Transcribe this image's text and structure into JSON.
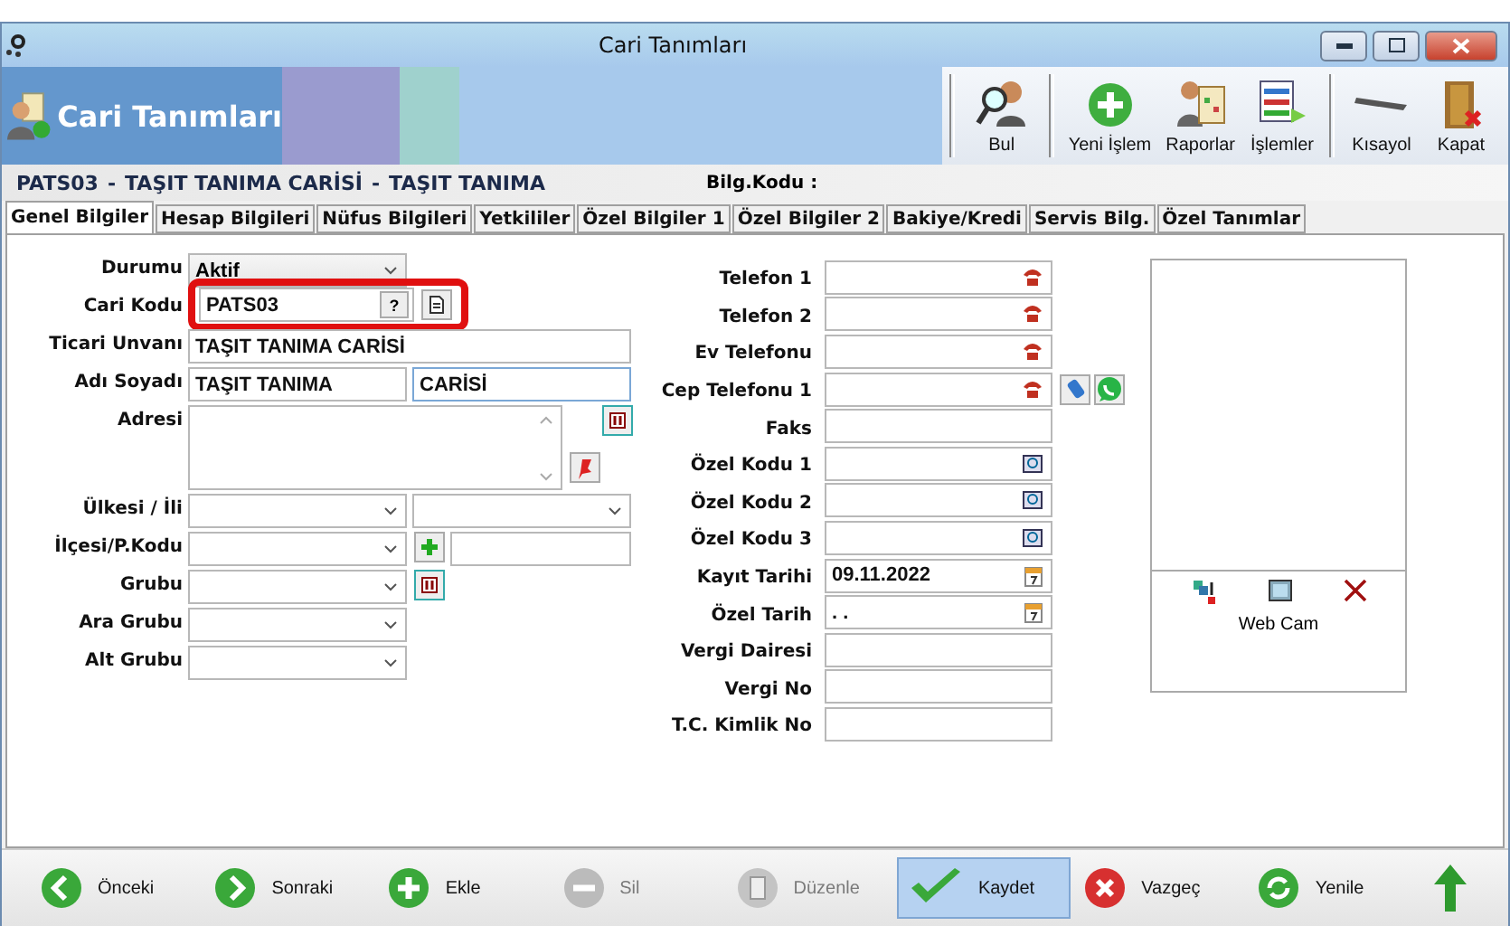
{
  "window": {
    "title": "Cari Tanımları"
  },
  "header": {
    "title": "Cari Tanımları"
  },
  "toolbar_groups": [
    [
      {
        "label": "Bul"
      }
    ],
    [
      {
        "label": "Yeni İşlem"
      },
      {
        "label": "Raporlar"
      },
      {
        "label": "İşlemler"
      }
    ],
    [
      {
        "label": "Kısayol"
      },
      {
        "label": "Kapat"
      }
    ]
  ],
  "record_title": [
    "PATS03",
    "-",
    "TAŞIT TANIMA CARİSİ",
    "-",
    "TAŞIT TANIMA"
  ],
  "bilg_kodu_label": "Bilg.Kodu :",
  "tabs": [
    {
      "label": "Genel Bilgiler",
      "selected": true
    },
    {
      "label": "Hesap Bilgileri",
      "selected": false
    },
    {
      "label": "Nüfus Bilgileri",
      "selected": false
    },
    {
      "label": "Yetkililer",
      "selected": false
    },
    {
      "label": "Özel Bilgiler 1",
      "selected": false
    },
    {
      "label": "Özel Bilgiler 2",
      "selected": false
    },
    {
      "label": "Bakiye/Kredi",
      "selected": false
    },
    {
      "label": "Servis Bilg.",
      "selected": false
    },
    {
      "label": "Özel Tanımlar",
      "selected": false
    }
  ],
  "left_fields": [
    {
      "kind": "select",
      "label": "Durumu",
      "value": "Aktif"
    },
    {
      "kind": "code",
      "label": "Cari Kodu",
      "value": "PATS03",
      "button": "?",
      "highlighted": true
    },
    {
      "kind": "text",
      "label": "Ticari Unvanı",
      "value": "TAŞIT TANIMA CARİSİ"
    },
    {
      "kind": "split",
      "label": "Adı Soyadı",
      "value": "TAŞIT TANIMA",
      "value2": "CARİSİ"
    },
    {
      "kind": "textarea",
      "label": "Adresi"
    },
    {
      "kind": "select_pair",
      "label": "Ülkesi / İli"
    },
    {
      "kind": "select_add",
      "label": "İlçesi/P.Kodu"
    },
    {
      "kind": "select_button",
      "label": "Grubu"
    },
    {
      "kind": "select",
      "label": "Ara Grubu"
    },
    {
      "kind": "select",
      "label": "Alt Grubu"
    }
  ],
  "right_fields": [
    {
      "kind": "phone",
      "label": "Telefon 1"
    },
    {
      "kind": "phone",
      "label": "Telefon 2"
    },
    {
      "kind": "phone",
      "label": "Ev Telefonu"
    },
    {
      "kind": "mobile",
      "label": "Cep Telefonu 1"
    },
    {
      "kind": "text",
      "label": "Faks"
    },
    {
      "kind": "lookup",
      "label": "Özel Kodu 1"
    },
    {
      "kind": "lookup",
      "label": "Özel Kodu 2"
    },
    {
      "kind": "lookup",
      "label": "Özel Kodu 3"
    },
    {
      "kind": "date",
      "label": "Kayıt Tarihi",
      "value": "09.11.2022"
    },
    {
      "kind": "date",
      "label": "Özel Tarih",
      "value": ". ."
    },
    {
      "kind": "text",
      "label": "Vergi Dairesi"
    },
    {
      "kind": "text",
      "label": "Vergi No"
    },
    {
      "kind": "text",
      "label": "T.C. Kimlik No"
    }
  ],
  "webcam": {
    "label": "Web Cam"
  },
  "bottom_buttons": [
    {
      "label": "Önceki",
      "disabled": false,
      "hovered": false
    },
    {
      "label": "Sonraki",
      "disabled": false,
      "hovered": false
    },
    {
      "label": "Ekle",
      "disabled": false,
      "hovered": false
    },
    {
      "label": "Sil",
      "disabled": true,
      "hovered": false
    },
    {
      "label": "Düzenle",
      "disabled": true,
      "hovered": false
    },
    {
      "label": "Kaydet",
      "disabled": false,
      "hovered": true
    },
    {
      "label": "Vazgeç",
      "disabled": false,
      "hovered": false
    },
    {
      "label": "Yenile",
      "disabled": false,
      "hovered": false
    },
    {
      "disabled": false,
      "hovered": false
    }
  ]
}
